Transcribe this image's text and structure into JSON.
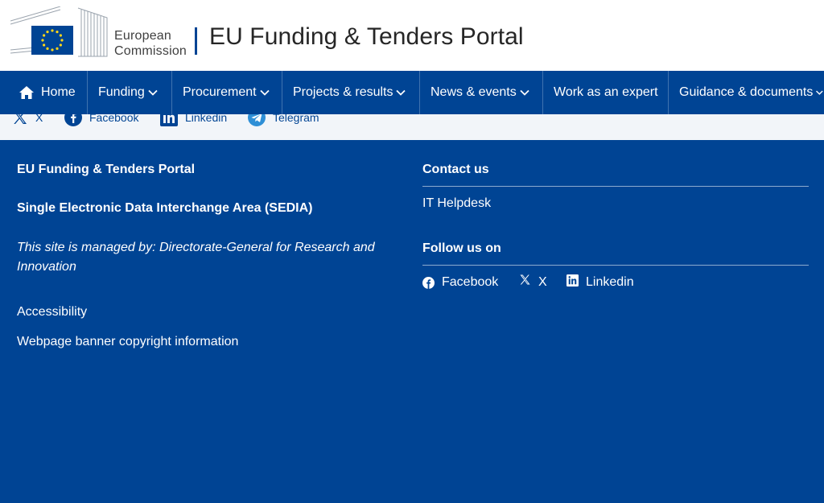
{
  "header": {
    "logo_line1": "European",
    "logo_line2": "Commission",
    "portal_title": "EU Funding & Tenders Portal"
  },
  "nav": {
    "items": [
      {
        "label": "Home",
        "icon": "home-icon"
      },
      {
        "label": "Funding",
        "icon": "chevron-down-icon"
      },
      {
        "label": "Procurement",
        "icon": "chevron-down-icon"
      },
      {
        "label": "Projects & results",
        "icon": "chevron-down-icon"
      },
      {
        "label": "News & events",
        "icon": "chevron-down-icon"
      },
      {
        "label": "Work as an expert"
      },
      {
        "label": "Guidance & documents",
        "icon": "chevron-down-icon"
      }
    ]
  },
  "social_strip": {
    "items": [
      {
        "label": "X",
        "icon": "x-icon"
      },
      {
        "label": "Facebook",
        "icon": "facebook-icon"
      },
      {
        "label": "Linkedin",
        "icon": "linkedin-icon"
      },
      {
        "label": "Telegram",
        "icon": "telegram-icon"
      }
    ]
  },
  "footer": {
    "portal_title": "EU Funding & Tenders Portal",
    "sedia": "Single Electronic Data Interchange Area (SEDIA)",
    "managed_by": "This site is managed by: Directorate-General for Research and Innovation",
    "accessibility": "Accessibility",
    "banner_copyright": "Webpage banner copyright information",
    "contact_heading": "Contact us",
    "it_helpdesk": "IT Helpdesk",
    "follow_heading": "Follow us on",
    "follow_items": [
      {
        "label": "Facebook",
        "icon": "facebook-icon"
      },
      {
        "label": "X",
        "icon": "x-icon"
      },
      {
        "label": "Linkedin",
        "icon": "linkedin-icon"
      }
    ]
  },
  "colors": {
    "brand_blue": "#004494",
    "strip_bg": "#f2f5f9",
    "eu_yellow": "#ffd617"
  }
}
